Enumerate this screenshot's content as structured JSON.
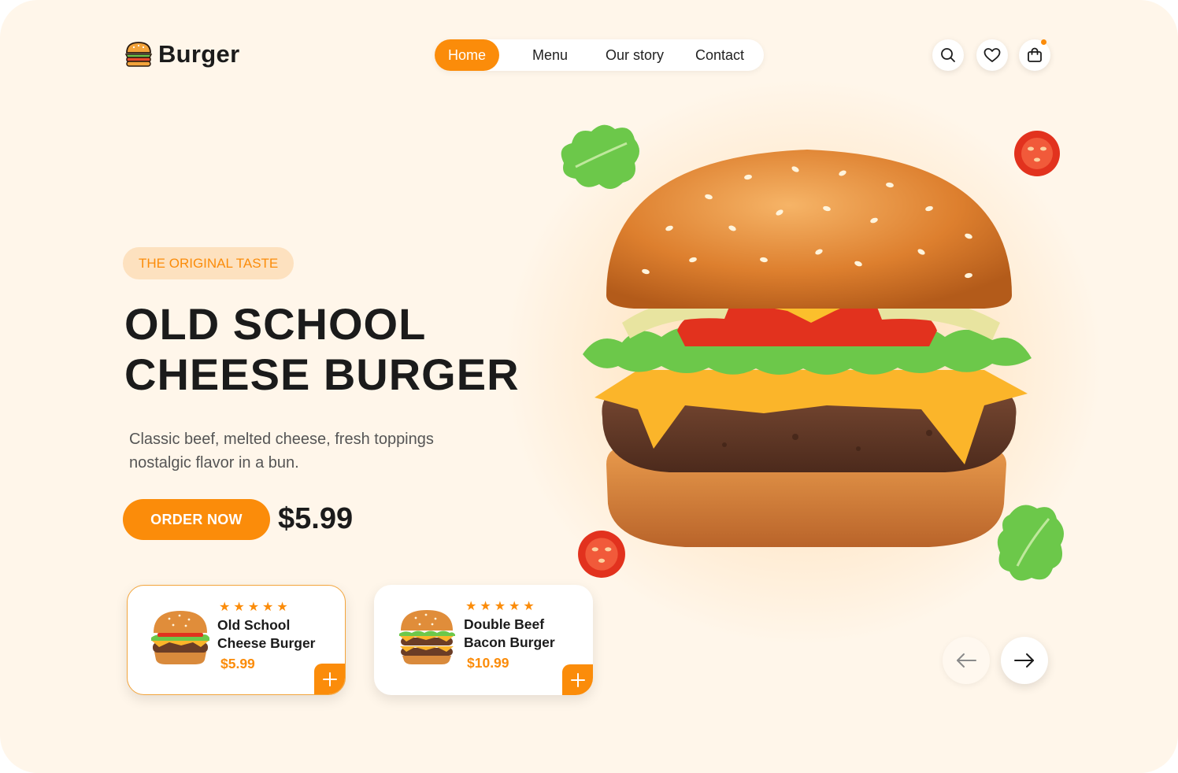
{
  "brand": {
    "name": "Burger",
    "logo_icon": "burger-icon"
  },
  "nav": {
    "items": [
      {
        "label": "Home",
        "active": true
      },
      {
        "label": "Menu",
        "active": false
      },
      {
        "label": "Our story",
        "active": false
      },
      {
        "label": "Contact",
        "active": false
      }
    ]
  },
  "header_icons": [
    "search-icon",
    "heart-icon",
    "shopping-bag-icon"
  ],
  "hero": {
    "tag": "THE ORIGINAL TASTE",
    "title_line1": "OLD SCHOOL",
    "title_line2": "CHEESE BURGER",
    "description": "Classic beef, melted cheese, fresh toppings nostalgic flavor in a bun.",
    "order_button": "ORDER NOW",
    "price": "$5.99"
  },
  "products": [
    {
      "name_line1": "Old School",
      "name_line2": "Cheese Burger",
      "price": "$5.99",
      "rating": 5,
      "selected": true
    },
    {
      "name_line1": "Double Beef",
      "name_line2": "Bacon Burger",
      "price": "$10.99",
      "rating": 5,
      "selected": false
    }
  ],
  "carousel": {
    "prev_icon": "arrow-left-icon",
    "next_icon": "arrow-right-icon"
  },
  "colors": {
    "accent": "#fb8c0a",
    "background": "#fff6ea",
    "tag_bg": "#fde1bf",
    "text": "#1b1b1b"
  }
}
